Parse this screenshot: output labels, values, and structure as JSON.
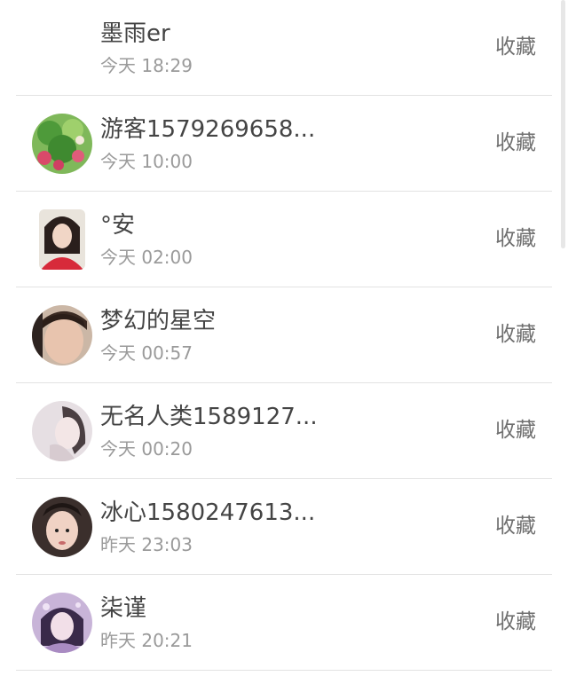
{
  "colors": {
    "divider": "#e3e3e3",
    "name_text": "#444444",
    "time_text": "#9a9a9a",
    "action_text": "#6f6f6f"
  },
  "contacts": [
    {
      "name": "墨雨er",
      "time": "今天 18:29",
      "action": "收藏",
      "avatar": "none"
    },
    {
      "name": "游客1579269658...",
      "time": "今天 10:00",
      "action": "收藏",
      "avatar": "green-plant-photo"
    },
    {
      "name": "°安",
      "time": "今天 02:00",
      "action": "收藏",
      "avatar": "girl-red-shirt-photo"
    },
    {
      "name": "梦幻的星空",
      "time": "今天 00:57",
      "action": "收藏",
      "avatar": "boy-face-photo"
    },
    {
      "name": "无名人类1589127...",
      "time": "今天 00:20",
      "action": "收藏",
      "avatar": "pale-girl-photo"
    },
    {
      "name": "冰心1580247613...",
      "time": "昨天 23:03",
      "action": "收藏",
      "avatar": "face-photo-dark"
    },
    {
      "name": "柒谨",
      "time": "昨天 20:21",
      "action": "收藏",
      "avatar": "purple-girl-photo"
    }
  ]
}
